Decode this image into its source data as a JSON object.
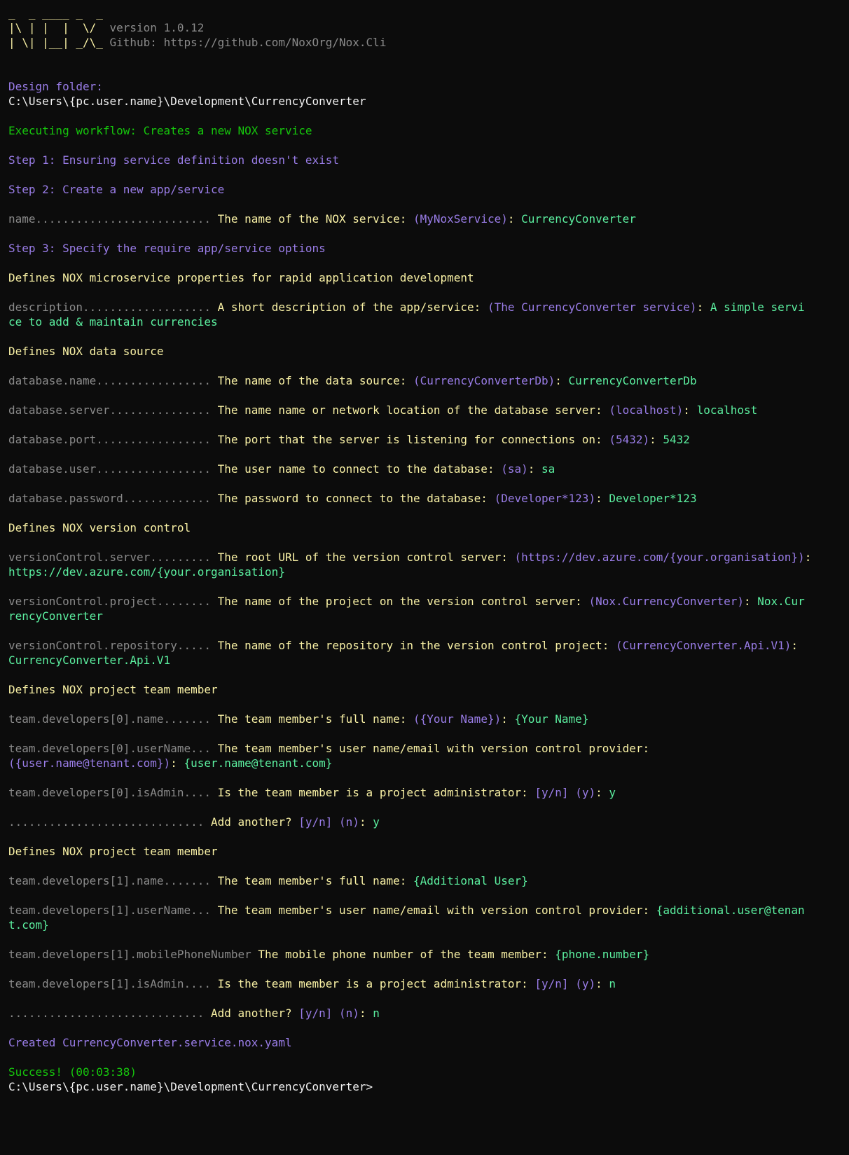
{
  "banner": {
    "art_line1": "_  _ ____ _  _",
    "art_line2": "|\\ | |  |  \\/ ",
    "art_line3": "| \\| |__| _/\\_",
    "version": "version 1.0.12",
    "github": "Github: https://github.com/NoxOrg/Nox.Cli"
  },
  "design_folder_label": "Design folder:",
  "design_folder_path": "C:\\Users\\{pc.user.name}\\Development\\CurrencyConverter",
  "workflow_line": "Executing workflow: Creates a new NOX service",
  "steps": {
    "step1": "Step 1: Ensuring service definition doesn't exist",
    "step2": "Step 2: Create a new app/service",
    "step3": "Step 3: Specify the require app/service options"
  },
  "q_name": {
    "key": "name.......................... ",
    "prompt": "The name of the NOX service: ",
    "default": "(MyNoxService)",
    "sep": ": ",
    "answer": "CurrencyConverter"
  },
  "section_props": "Defines NOX microservice properties for rapid application development",
  "q_description": {
    "key": "description................... ",
    "prompt": "A short description of the app/service: ",
    "default": "(The CurrencyConverter service)",
    "sep": ": ",
    "answer1": "A simple servi",
    "answer2": "ce to add & maintain currencies"
  },
  "section_datasource": "Defines NOX data source",
  "q_db_name": {
    "key": "database.name................. ",
    "prompt": "The name of the data source: ",
    "default": "(CurrencyConverterDb)",
    "sep": ": ",
    "answer": "CurrencyConverterDb"
  },
  "q_db_server": {
    "key": "database.server............... ",
    "prompt": "The name name or network location of the database server: ",
    "default": "(localhost)",
    "sep": ": ",
    "answer": "localhost"
  },
  "q_db_port": {
    "key": "database.port................. ",
    "prompt": "The port that the server is listening for connections on: ",
    "default": "(5432)",
    "sep": ": ",
    "answer": "5432"
  },
  "q_db_user": {
    "key": "database.user................. ",
    "prompt": "The user name to connect to the database: ",
    "default": "(sa)",
    "sep": ": ",
    "answer": "sa"
  },
  "q_db_password": {
    "key": "database.password............. ",
    "prompt": "The password to connect to the database: ",
    "default": "(Developer*123)",
    "sep": ": ",
    "answer": "Developer*123"
  },
  "section_vc": "Defines NOX version control",
  "q_vc_server": {
    "key": "versionControl.server......... ",
    "prompt": "The root URL of the version control server: ",
    "default": "(https://dev.azure.com/{your.organisation})",
    "sep": ":",
    "answer": "https://dev.azure.com/{your.organisation}"
  },
  "q_vc_project": {
    "key": "versionControl.project........ ",
    "prompt": "The name of the project on the version control server: ",
    "default": "(Nox.CurrencyConverter)",
    "sep": ": ",
    "answer1": "Nox.Cur",
    "answer2": "rencyConverter"
  },
  "q_vc_repo": {
    "key": "versionControl.repository..... ",
    "prompt": "The name of the repository in the version control project: ",
    "default": "(CurrencyConverter.Api.V1)",
    "sep": ":",
    "answer": "CurrencyConverter.Api.V1"
  },
  "section_team1": "Defines NOX project team member",
  "q_dev0_name": {
    "key": "team.developers[0].name....... ",
    "prompt": "The team member's full name: ",
    "default": "({Your Name})",
    "sep": ": ",
    "answer": "{Your Name}"
  },
  "q_dev0_user": {
    "key": "team.developers[0].userName... ",
    "prompt": "The team member's user name/email with version control provider:",
    "default": "({user.name@tenant.com})",
    "sep": ": ",
    "answer": "{user.name@tenant.com}"
  },
  "q_dev0_admin": {
    "key": "team.developers[0].isAdmin.... ",
    "prompt": "Is the team member is a project administrator: ",
    "options": "[y/n]",
    "default": "(y)",
    "sep": ": ",
    "answer": "y"
  },
  "q_add1": {
    "key": "............................. ",
    "prompt": "Add another? ",
    "options": "[y/n]",
    "default": "(n)",
    "sep": ": ",
    "answer": "y"
  },
  "section_team2": "Defines NOX project team member",
  "q_dev1_name": {
    "key": "team.developers[1].name....... ",
    "prompt": "The team member's full name: ",
    "answer": "{Additional User}"
  },
  "q_dev1_user": {
    "key": "team.developers[1].userName... ",
    "prompt": "The team member's user name/email with version control provider: ",
    "answer1": "{additional.user@tenan",
    "answer2": "t.com}"
  },
  "q_dev1_phone": {
    "key": "team.developers[1].mobilePhoneNumber ",
    "prompt": "The mobile phone number of the team member: ",
    "answer": "{phone.number}"
  },
  "q_dev1_admin": {
    "key": "team.developers[1].isAdmin.... ",
    "prompt": "Is the team member is a project administrator: ",
    "options": "[y/n]",
    "default": "(y)",
    "sep": ": ",
    "answer": "n"
  },
  "q_add2": {
    "key": "............................. ",
    "prompt": "Add another? ",
    "options": "[y/n]",
    "default": "(n)",
    "sep": ": ",
    "answer": "n"
  },
  "created_line": "Created CurrencyConverter.service.nox.yaml",
  "success_line": "Success! (00:03:38)",
  "prompt_line": "C:\\Users\\{pc.user.name}\\Development\\CurrencyConverter>",
  "colors": {
    "background": "#0c0c0c",
    "purple": "#9a7de8",
    "green": "#16c60c",
    "light_green": "#5cf0a0",
    "yellow": "#f9f1a5",
    "grey": "#8a8a8a"
  }
}
